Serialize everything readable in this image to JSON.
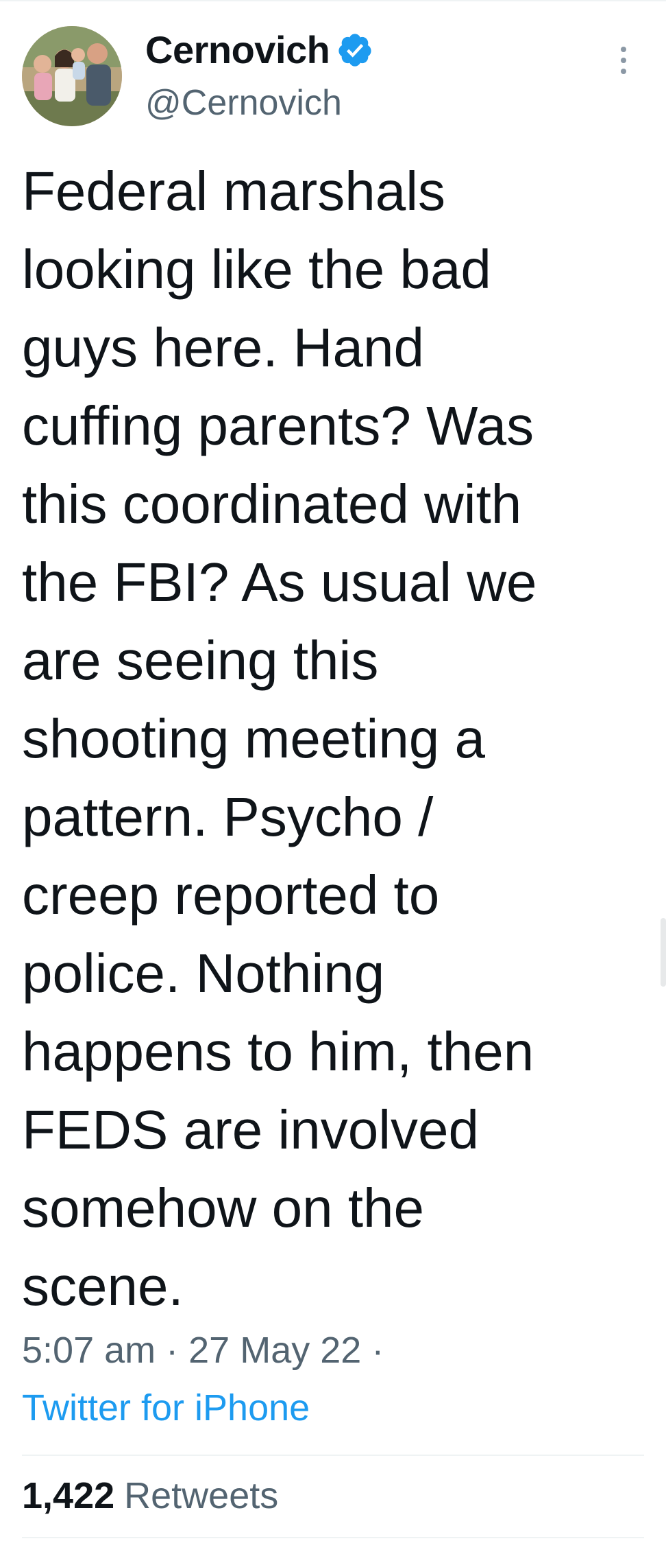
{
  "author": {
    "display_name": "Cernovich",
    "handle": "@Cernovich",
    "verified": true,
    "avatar_icon": "profile-photo-family"
  },
  "tweet": {
    "text": "Federal marshals\nlooking like the bad\nguys here. Hand\ncuffing parents? Was\nthis coordinated with\nthe FBI? As usual we\nare seeing this\nshooting meeting a\npattern. Psycho /\ncreep reported to\npolice. Nothing\nhappens to him, then\nFEDS are involved\nsomehow on the\nscene.",
    "time": "5:07 am",
    "date": "27 May 22",
    "separator": "·",
    "source": "Twitter for iPhone"
  },
  "stats": {
    "retweets_count": "1,422",
    "retweets_label": "Retweets"
  },
  "colors": {
    "text_primary": "#0f1419",
    "text_secondary": "#536471",
    "link": "#1d9bf0",
    "verified_badge": "#1d9bf0",
    "divider": "#eff3f4"
  },
  "icons": {
    "verified": "verified-badge-icon",
    "more": "more-options-icon"
  }
}
